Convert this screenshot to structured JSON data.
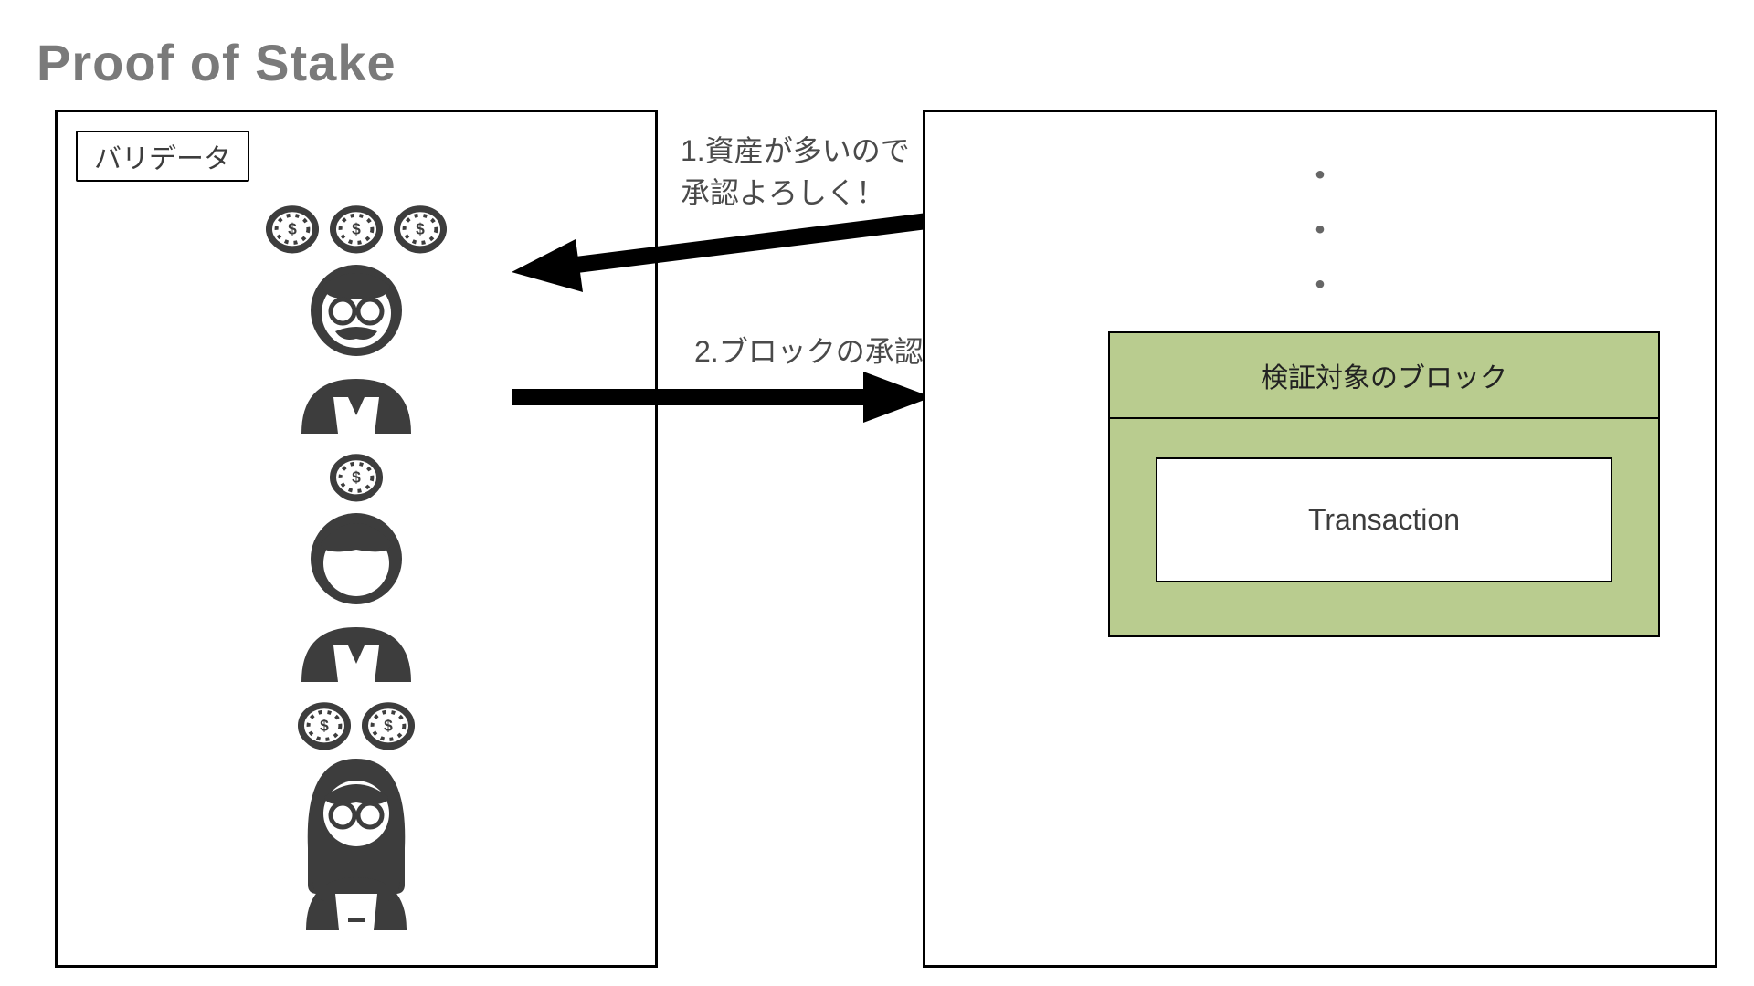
{
  "title": "Proof of Stake",
  "left_panel": {
    "label": "バリデータ",
    "validators": [
      {
        "coins": 3,
        "avatar": "mustache"
      },
      {
        "coins": 1,
        "avatar": "man"
      },
      {
        "coins": 2,
        "avatar": "woman"
      }
    ]
  },
  "arrows": {
    "request": {
      "label_line1": "1.資産が多いので",
      "label_line2": "承認よろしく！"
    },
    "approve": {
      "label": "2.ブロックの承認"
    }
  },
  "right_panel": {
    "block_title": "検証対象のブロック",
    "transaction_label": "Transaction"
  },
  "colors": {
    "block_fill": "#b9cc8f",
    "icon_fill": "#3d3d3d"
  }
}
